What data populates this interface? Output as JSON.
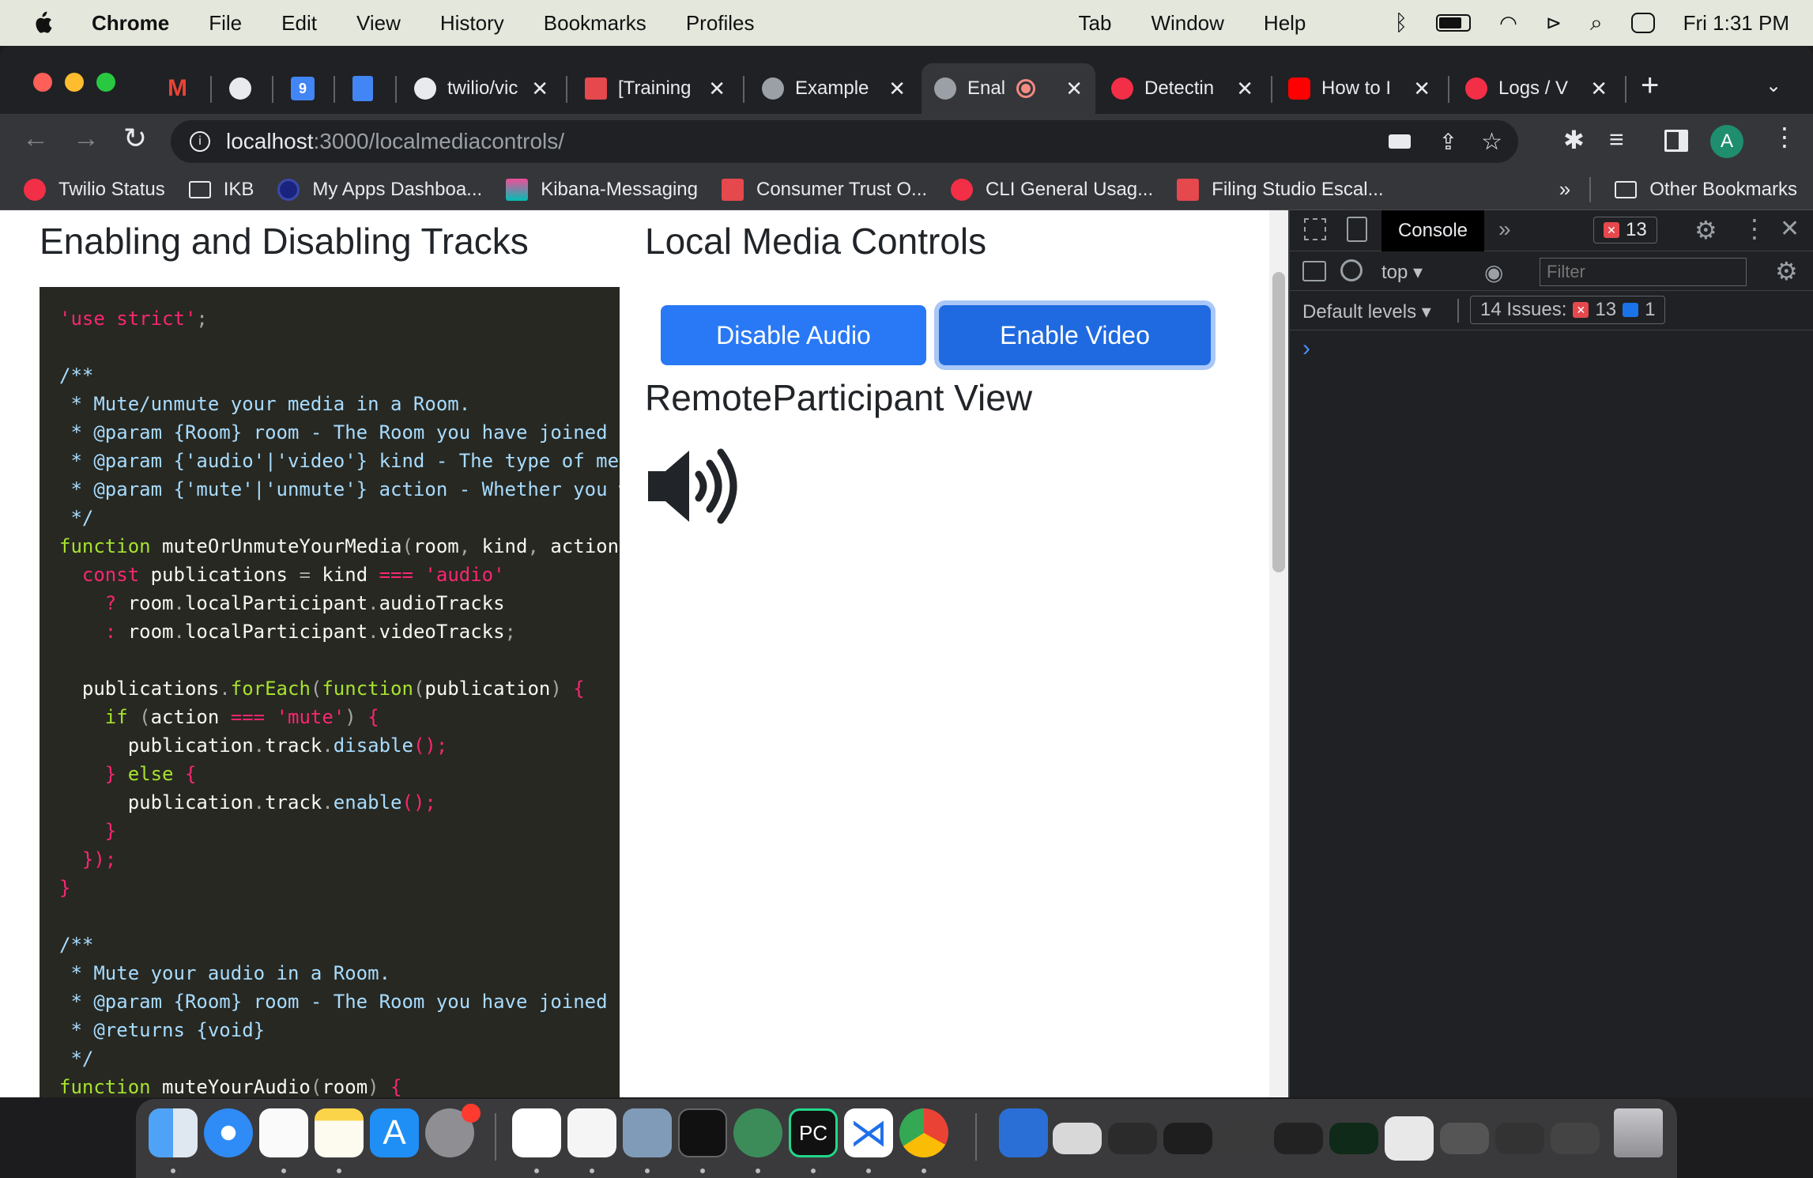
{
  "menubar": {
    "app": "Chrome",
    "menus": [
      "File",
      "Edit",
      "View",
      "History",
      "Bookmarks",
      "Profiles",
      "Tab",
      "Window",
      "Help"
    ],
    "clock": "Fri  1:31 PM"
  },
  "tabs": [
    {
      "title": "",
      "icon": "gmail-icon"
    },
    {
      "title": "",
      "icon": "tool-icon"
    },
    {
      "title": "",
      "icon": "calendar-icon",
      "badge": "9"
    },
    {
      "title": "",
      "icon": "docs-icon"
    },
    {
      "title": "twilio/vic",
      "icon": "github-icon"
    },
    {
      "title": "[Training",
      "icon": "confluence-icon"
    },
    {
      "title": "Example",
      "icon": "globe-icon"
    },
    {
      "title": "Enal",
      "icon": "globe-icon",
      "active": true
    },
    {
      "title": "Detectin",
      "icon": "twilio-icon"
    },
    {
      "title": "How to I",
      "icon": "youtube-icon"
    },
    {
      "title": "Logs / V",
      "icon": "twilio-icon"
    }
  ],
  "address": {
    "host": "localhost",
    "rest": ":3000/localmediacontrols/"
  },
  "profile_initial": "A",
  "bookmarks": [
    {
      "label": "Twilio Status",
      "icon": "twilio-icon"
    },
    {
      "label": "IKB",
      "icon": "folder-icon"
    },
    {
      "label": "My Apps Dashboa...",
      "icon": "okta-icon"
    },
    {
      "label": "Kibana-Messaging",
      "icon": "kibana-icon"
    },
    {
      "label": "Consumer Trust O...",
      "icon": "confluence-icon"
    },
    {
      "label": "CLI General Usag...",
      "icon": "twilio-icon"
    },
    {
      "label": "Filing Studio Escal...",
      "icon": "confluence-icon"
    }
  ],
  "bookmarks_overflow": "»",
  "other_bookmarks": "Other Bookmarks",
  "page": {
    "left_title": "Enabling and Disabling Tracks",
    "right_title": "Local Media Controls",
    "btn_audio": "Disable Audio",
    "btn_video": "Enable Video",
    "remote_title": "RemoteParticipant View"
  },
  "devtools": {
    "tab_console": "Console",
    "errors": "13",
    "context": "top",
    "filter_placeholder": "Filter",
    "levels": "Default levels ▾",
    "issues_label": "14 Issues:",
    "issues_errors": "13",
    "issues_info": "1",
    "prompt": "›"
  }
}
